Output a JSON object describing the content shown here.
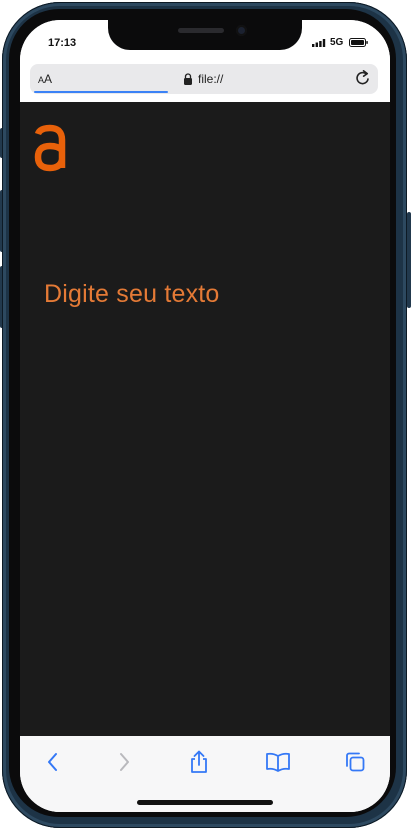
{
  "status_bar": {
    "time": "17:13",
    "network": "5G",
    "icons": [
      "signal-icon",
      "battery-icon"
    ]
  },
  "browser": {
    "text_size_label_small": "A",
    "text_size_label_large": "A",
    "url": "file://",
    "icons": [
      "lock-icon",
      "reload-icon"
    ],
    "accent_color": "#3b82f6"
  },
  "page": {
    "logo": "a",
    "heading": "Digite seu texto",
    "text_color": "#e47a36",
    "background_color": "#1b1b1b"
  },
  "toolbar": {
    "items": [
      "back-icon",
      "forward-icon",
      "share-icon",
      "bookmarks-icon",
      "tabs-icon"
    ],
    "active_color": "#3478f6",
    "disabled_color": "#b9b9bd"
  }
}
